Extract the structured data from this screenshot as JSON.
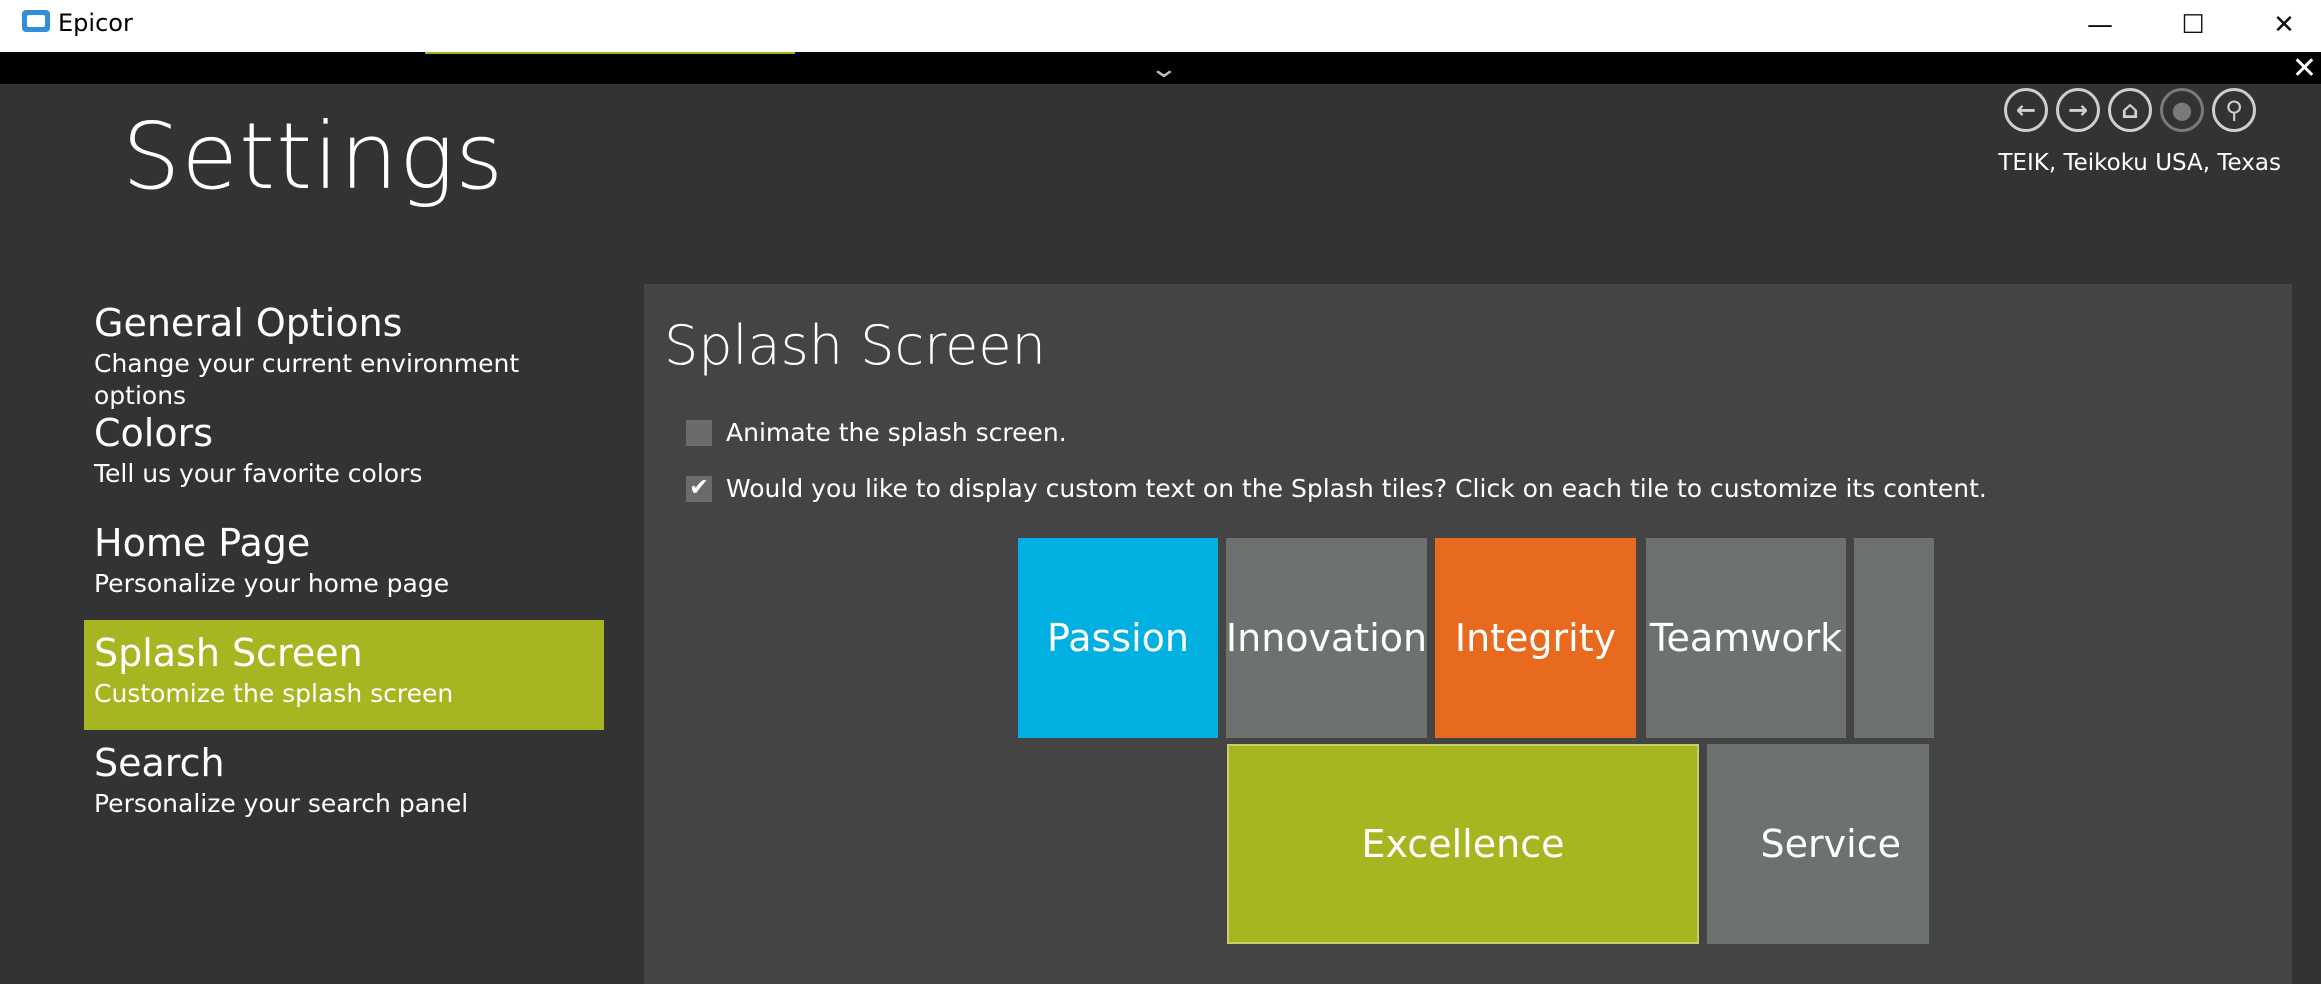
{
  "window": {
    "title": "Epicor",
    "minimize": "—",
    "maximize": "☐",
    "close": "✕"
  },
  "strip": {
    "chevron": "⌄",
    "close": "✕"
  },
  "page": {
    "title": "Settings"
  },
  "nav": {
    "back_icon": "←",
    "forward_icon": "→",
    "home_icon": "⌂",
    "chat_icon": "●",
    "search_icon": "⚲",
    "company": "TEIK, Teikoku USA, Texas"
  },
  "menu": {
    "items": [
      {
        "title": "General Options",
        "subtitle": "Change your current environment options"
      },
      {
        "title": "Colors",
        "subtitle": "Tell us your favorite colors"
      },
      {
        "title": "Home Page",
        "subtitle": "Personalize your home page"
      },
      {
        "title": "Splash Screen",
        "subtitle": "Customize the splash screen"
      },
      {
        "title": "Search",
        "subtitle": "Personalize your search panel"
      }
    ],
    "active_index": 3
  },
  "panel": {
    "title": "Splash Screen",
    "animate_label": "Animate the splash screen.",
    "animate_checked": false,
    "custom_text_label": "Would you like to display custom text on the Splash tiles? Click on each tile to customize its content.",
    "custom_text_checked": true
  },
  "tiles": [
    {
      "label": "Passion",
      "color": "#00b0e0"
    },
    {
      "label": "Innovation",
      "color": "#6e7171"
    },
    {
      "label": "Integrity",
      "color": "#e86a1f"
    },
    {
      "label": "Teamwork",
      "color": "#6e7171"
    },
    {
      "label": "",
      "color": "#6e7171"
    },
    {
      "label": "Excellence",
      "color": "#a6b520"
    },
    {
      "label": "Service",
      "color": "#6e7171"
    }
  ],
  "colors": {
    "accent": "#a6b520",
    "background": "#333333",
    "panel": "#444444"
  }
}
